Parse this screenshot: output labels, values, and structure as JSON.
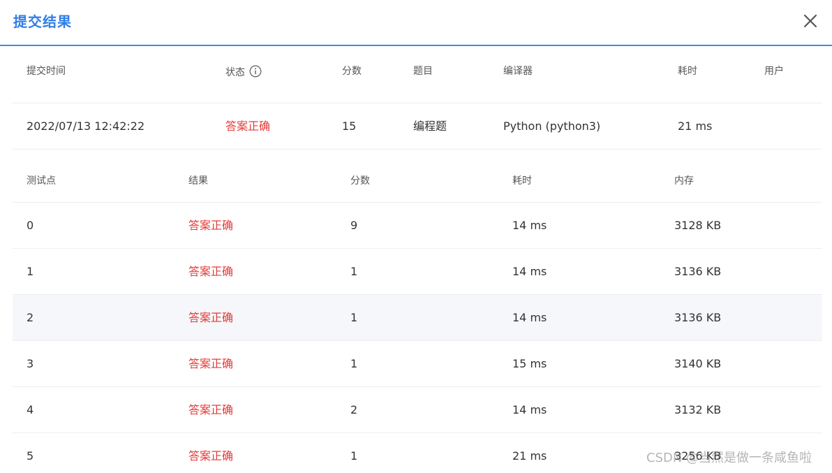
{
  "dialog": {
    "title": "提交结果"
  },
  "summary": {
    "headers": {
      "time": "提交时间",
      "status": "状态",
      "score": "分数",
      "problem": "题目",
      "compiler": "编译器",
      "elapsed": "耗时",
      "user": "用户"
    },
    "row": {
      "time": "2022/07/13 12:42:22",
      "status": "答案正确",
      "score": "15",
      "problem": "编程题",
      "compiler": "Python (python3)",
      "elapsed": "21 ms",
      "user": ""
    }
  },
  "testcases": {
    "headers": {
      "case": "测试点",
      "result": "结果",
      "score": "分数",
      "elapsed": "耗时",
      "memory": "内存"
    },
    "rows": [
      {
        "case": "0",
        "result": "答案正确",
        "score": "9",
        "elapsed": "14 ms",
        "memory": "3128 KB"
      },
      {
        "case": "1",
        "result": "答案正确",
        "score": "1",
        "elapsed": "14 ms",
        "memory": "3136 KB"
      },
      {
        "case": "2",
        "result": "答案正确",
        "score": "1",
        "elapsed": "14 ms",
        "memory": "3136 KB"
      },
      {
        "case": "3",
        "result": "答案正确",
        "score": "1",
        "elapsed": "15 ms",
        "memory": "3140 KB"
      },
      {
        "case": "4",
        "result": "答案正确",
        "score": "2",
        "elapsed": "14 ms",
        "memory": "3132 KB"
      },
      {
        "case": "5",
        "result": "答案正确",
        "score": "1",
        "elapsed": "21 ms",
        "memory": "3256 KB"
      }
    ]
  },
  "watermark": "CSDN @当然是做一条咸鱼啦",
  "colors": {
    "accent": "#2f7fe8",
    "success_text": "#e53935",
    "row_highlight": "#f5f7fa"
  },
  "icons": {
    "close": "close-icon",
    "status_info": "info-icon"
  }
}
